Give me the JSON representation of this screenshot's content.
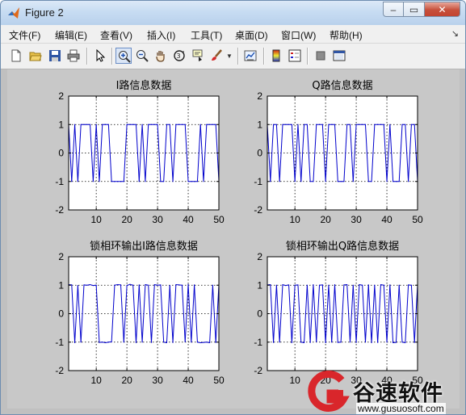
{
  "window": {
    "title": "Figure 2"
  },
  "window_buttons": {
    "minimize": "–",
    "maximize": "▭",
    "close": "✕"
  },
  "menu": {
    "items": [
      "文件(F)",
      "编辑(E)",
      "查看(V)",
      "插入(I)",
      "工具(T)",
      "桌面(D)",
      "窗口(W)",
      "帮助(H)"
    ],
    "overflow": "↘"
  },
  "toolbar": {
    "icons": [
      "new-file-icon",
      "open-folder-icon",
      "save-icon",
      "print-icon",
      "pointer-icon",
      "zoom-in-icon",
      "zoom-out-icon",
      "pan-icon",
      "rotate-3d-icon",
      "data-cursor-icon",
      "brush-icon",
      "link-plot-icon",
      "colorbar-icon",
      "legend-icon",
      "hide-plot-tools-icon",
      "show-plot-tools-icon"
    ],
    "active": "zoom-in-icon"
  },
  "colors": {
    "plot_bg": "#ffffff",
    "figure_bg": "#c8c8c8",
    "series": "#0000cc",
    "grid": "#000000"
  },
  "watermark": {
    "name": "谷速软件",
    "url": "www.gusuosoft.com"
  },
  "chart_data": [
    {
      "type": "line",
      "title": "I路信息数据",
      "xlim": [
        1,
        50
      ],
      "ylim": [
        -2,
        2
      ],
      "xticks": [
        10,
        20,
        30,
        40,
        50
      ],
      "yticks": [
        2,
        1,
        0,
        -1,
        -2
      ],
      "grid": true,
      "grid_style": "dotted",
      "x": [
        1,
        2,
        3,
        4,
        5,
        6,
        7,
        8,
        9,
        10,
        11,
        12,
        13,
        14,
        15,
        16,
        17,
        18,
        19,
        20,
        21,
        22,
        23,
        24,
        25,
        26,
        27,
        28,
        29,
        30,
        31,
        32,
        33,
        34,
        35,
        36,
        37,
        38,
        39,
        40,
        41,
        42,
        43,
        44,
        45,
        46,
        47,
        48,
        49,
        50
      ],
      "series": [
        {
          "values": [
            1,
            -1,
            1,
            -1,
            1,
            1,
            1,
            1,
            -1,
            1,
            -1,
            1,
            1,
            1,
            -1,
            -1,
            -1,
            -1,
            -1,
            1,
            1,
            1,
            1,
            -1,
            1,
            -1,
            1,
            1,
            1,
            1,
            -1,
            -1,
            1,
            1,
            -1,
            1,
            1,
            1,
            1,
            -1,
            -1,
            -1,
            -1,
            1,
            -1,
            1,
            1,
            1,
            1,
            -1
          ]
        }
      ]
    },
    {
      "type": "line",
      "title": "Q路信息数据",
      "xlim": [
        1,
        50
      ],
      "ylim": [
        -2,
        2
      ],
      "xticks": [
        10,
        20,
        30,
        40,
        50
      ],
      "yticks": [
        2,
        1,
        0,
        -1,
        -2
      ],
      "grid": true,
      "grid_style": "dotted",
      "x": [
        1,
        2,
        3,
        4,
        5,
        6,
        7,
        8,
        9,
        10,
        11,
        12,
        13,
        14,
        15,
        16,
        17,
        18,
        19,
        20,
        21,
        22,
        23,
        24,
        25,
        26,
        27,
        28,
        29,
        30,
        31,
        32,
        33,
        34,
        35,
        36,
        37,
        38,
        39,
        40,
        41,
        42,
        43,
        44,
        45,
        46,
        47,
        48,
        49,
        50
      ],
      "series": [
        {
          "values": [
            1,
            -1,
            1,
            1,
            -1,
            1,
            1,
            1,
            1,
            -1,
            1,
            -1,
            1,
            1,
            -1,
            -1,
            1,
            1,
            1,
            -1,
            1,
            1,
            1,
            -1,
            -1,
            -1,
            1,
            1,
            -1,
            1,
            1,
            1,
            1,
            -1,
            -1,
            1,
            1,
            1,
            1,
            -1,
            1,
            -1,
            -1,
            -1,
            1,
            1,
            -1,
            1,
            1,
            -1
          ]
        }
      ]
    },
    {
      "type": "line",
      "title": "锁相环输出I路信息数据",
      "xlim": [
        1,
        50
      ],
      "ylim": [
        -2,
        2
      ],
      "xticks": [
        10,
        20,
        30,
        40,
        50
      ],
      "yticks": [
        2,
        1,
        0,
        -1,
        -2
      ],
      "grid": true,
      "grid_style": "dotted",
      "x": [
        1,
        2,
        3,
        4,
        5,
        6,
        7,
        8,
        9,
        10,
        11,
        12,
        13,
        14,
        15,
        16,
        17,
        18,
        19,
        20,
        21,
        22,
        23,
        24,
        25,
        26,
        27,
        28,
        29,
        30,
        31,
        32,
        33,
        34,
        35,
        36,
        37,
        38,
        39,
        40,
        41,
        42,
        43,
        44,
        45,
        46,
        47,
        48,
        49,
        50
      ],
      "series": [
        {
          "values": [
            1.02,
            1.01,
            -1.02,
            0.99,
            -1,
            1.01,
            1,
            1.02,
            0.99,
            1,
            -1.01,
            -1,
            -1.02,
            -1,
            -0.99,
            1,
            1.02,
            1.01,
            -1,
            0.99,
            1.03,
            1,
            -1.02,
            1.01,
            -1,
            1.02,
            1,
            -1.01,
            1.02,
            1,
            1.01,
            -1,
            -1.02,
            0.99,
            -1.01,
            1.02,
            1.01,
            1,
            -0.99,
            1.03,
            -1,
            1.01,
            -1,
            -1.02,
            -1.01,
            -1,
            -1.02,
            1,
            -1.01,
            1.02
          ]
        }
      ]
    },
    {
      "type": "line",
      "title": "锁相环输出Q路信息数据",
      "xlim": [
        1,
        50
      ],
      "ylim": [
        -2,
        2
      ],
      "xticks": [
        10,
        20,
        30,
        40,
        50
      ],
      "yticks": [
        2,
        1,
        0,
        -1,
        -2
      ],
      "grid": true,
      "grid_style": "dotted",
      "x": [
        1,
        2,
        3,
        4,
        5,
        6,
        7,
        8,
        9,
        10,
        11,
        12,
        13,
        14,
        15,
        16,
        17,
        18,
        19,
        20,
        21,
        22,
        23,
        24,
        25,
        26,
        27,
        28,
        29,
        30,
        31,
        32,
        33,
        34,
        35,
        36,
        37,
        38,
        39,
        40,
        41,
        42,
        43,
        44,
        45,
        46,
        47,
        48,
        49,
        50
      ],
      "series": [
        {
          "values": [
            1.01,
            1.02,
            -1.01,
            1,
            -1,
            1.02,
            0.99,
            1.01,
            -1.02,
            1,
            1.01,
            -1,
            -1.02,
            1,
            -1.01,
            1.02,
            -0.99,
            1,
            1.01,
            -1.02,
            1,
            -1,
            1.02,
            -1.01,
            -1,
            1.01,
            1.02,
            -1,
            1,
            -1.01,
            1.02,
            1,
            -1,
            1.01,
            -1.02,
            1,
            -1.01,
            1.02,
            1,
            -1,
            1.01,
            -1.02,
            -1.01,
            1,
            -1,
            -1.02,
            1.01,
            1,
            -1.01,
            1.02
          ]
        }
      ]
    }
  ]
}
